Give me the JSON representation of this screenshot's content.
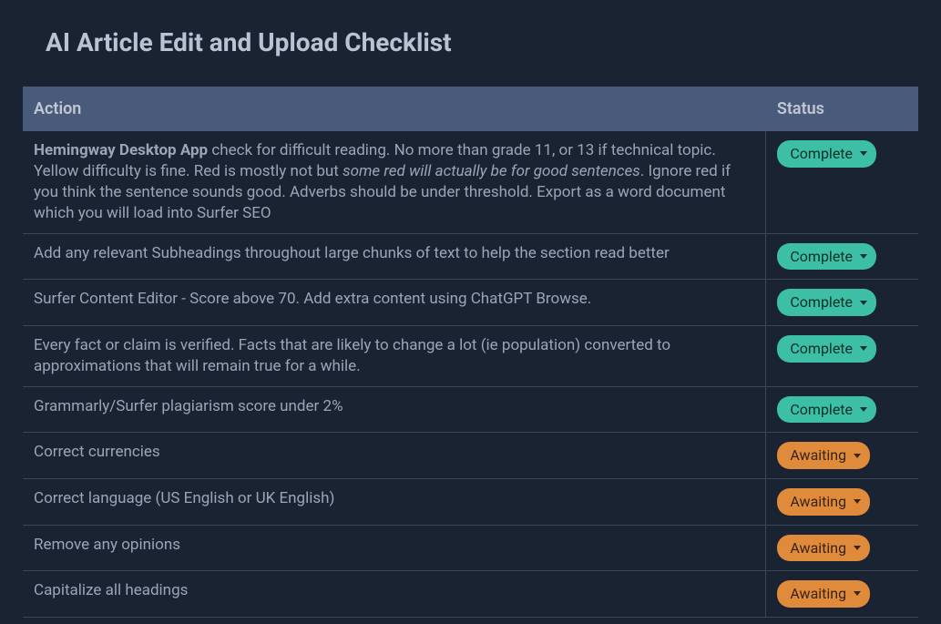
{
  "title": "AI Article Edit and Upload Checklist",
  "headers": {
    "action": "Action",
    "status": "Status"
  },
  "statuses": {
    "complete": "Complete",
    "awaiting": "Awaiting"
  },
  "rows": [
    {
      "action_bold_prefix": "Hemingway Desktop App",
      "action_text_1": " check for difficult reading. No more than grade 11, or 13 if technical topic. Yellow difficulty is fine. Red is mostly not but ",
      "action_italic": "some red will actually be for good sentences",
      "action_text_2": ". Ignore red if you think the sentence sounds good. Adverbs should be under threshold. Export as a word document which you will load into Surfer SEO",
      "status": "complete"
    },
    {
      "action_text_1": "Add any relevant Subheadings throughout large chunks of text to help the section read better",
      "status": "complete"
    },
    {
      "action_text_1": "Surfer Content Editor - Score above 70. Add extra content using ChatGPT Browse.",
      "status": "complete"
    },
    {
      "action_text_1": "Every fact or claim is verified. Facts that are likely to change a lot (ie population) converted to approximations that will remain true for a while.",
      "status": "complete"
    },
    {
      "action_text_1": "Grammarly/Surfer plagiarism score under 2%",
      "status": "complete"
    },
    {
      "action_text_1": "Correct currencies",
      "status": "awaiting"
    },
    {
      "action_text_1": "Correct language (US English or UK English)",
      "status": "awaiting"
    },
    {
      "action_text_1": "Remove any opinions",
      "status": "awaiting"
    },
    {
      "action_text_1": "Capitalize all headings",
      "status": "awaiting"
    }
  ]
}
